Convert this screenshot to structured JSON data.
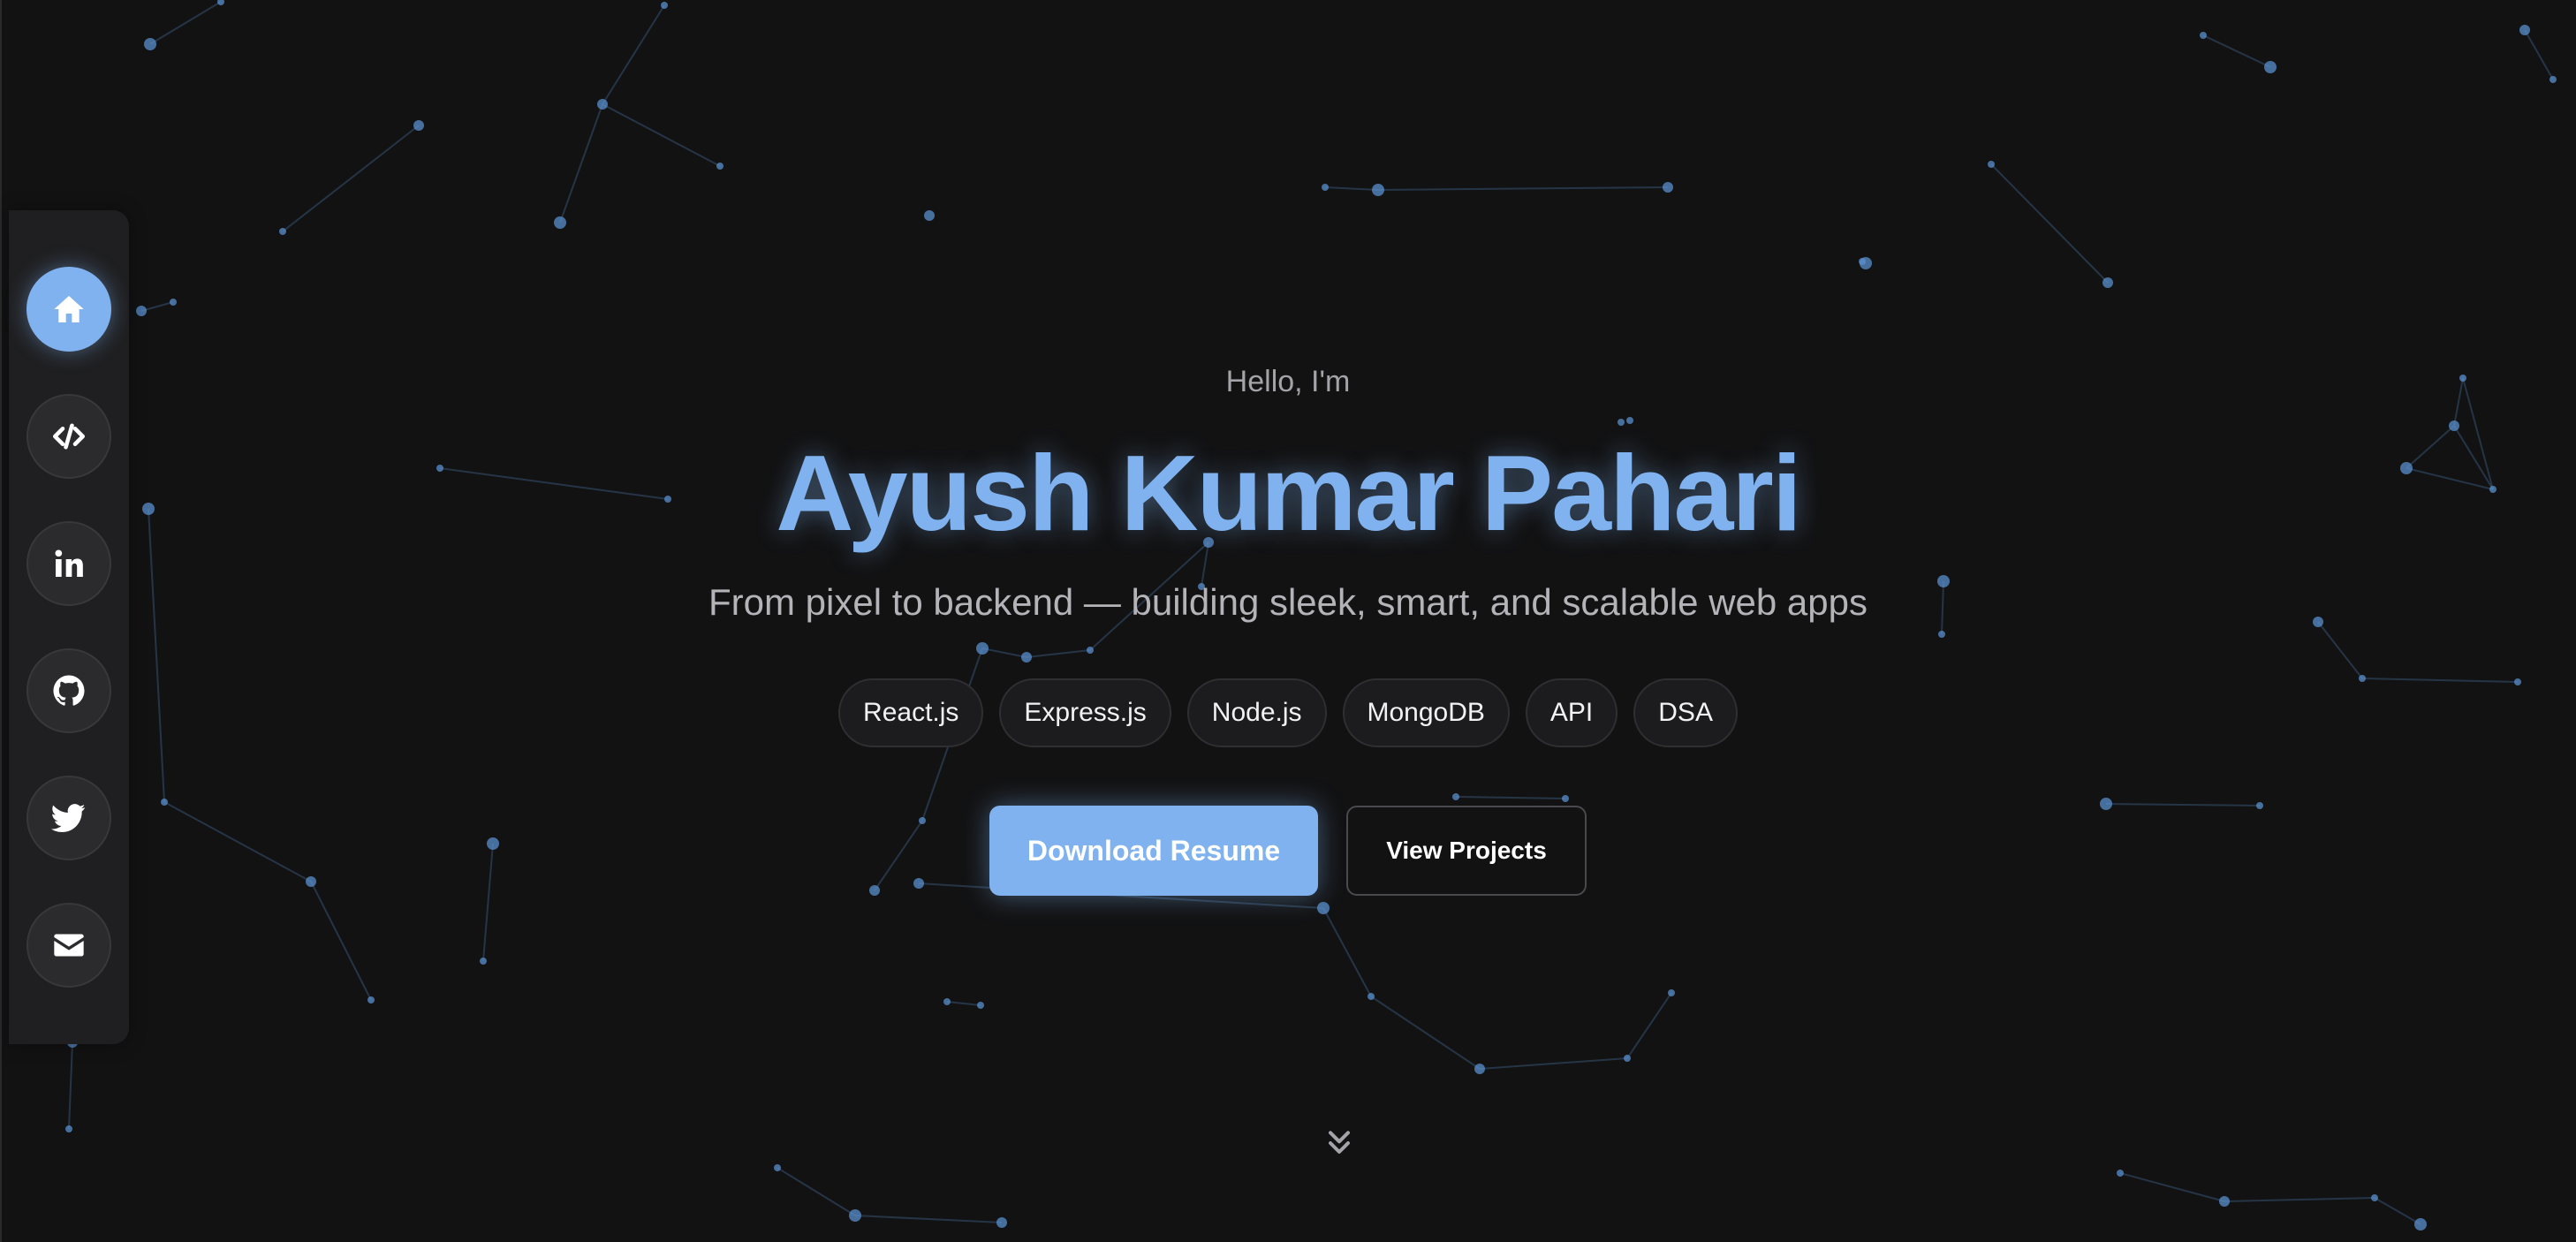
{
  "colors": {
    "accent": "#7fb2ee",
    "background": "#121213",
    "sidebar": "#1f1f21",
    "particle": "#5a8fce"
  },
  "sidebar": {
    "items": [
      {
        "icon": "home-icon",
        "active": true
      },
      {
        "icon": "code-icon",
        "active": false
      },
      {
        "icon": "linkedin-icon",
        "active": false
      },
      {
        "icon": "github-icon",
        "active": false
      },
      {
        "icon": "twitter-icon",
        "active": false
      },
      {
        "icon": "mail-icon",
        "active": false
      }
    ]
  },
  "hero": {
    "greeting": "Hello, I'm",
    "name": "Ayush Kumar Pahari",
    "tagline": "From pixel to backend — building sleek, smart, and scalable web apps",
    "skills": [
      "React.js",
      "Express.js",
      "Node.js",
      "MongoDB",
      "API",
      "DSA"
    ],
    "primary_button": "Download Resume",
    "secondary_button": "View Projects",
    "scroll_icon": "chevrons-down-icon"
  }
}
